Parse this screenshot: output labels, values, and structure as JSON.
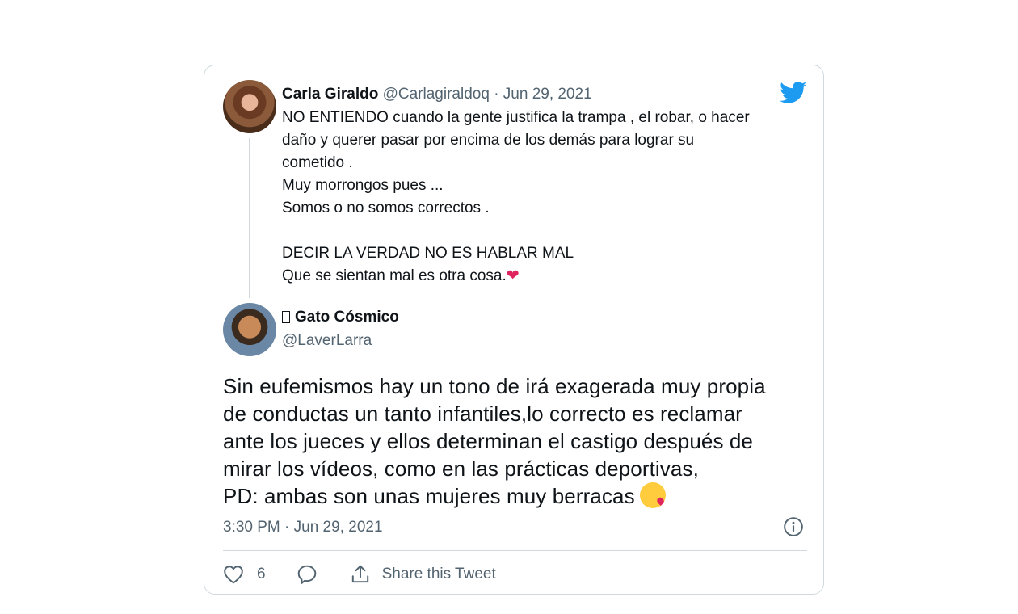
{
  "quoted_tweet": {
    "name": "Carla Giraldo",
    "handle": "@Carlagiraldoq",
    "separator": "·",
    "date": "Jun 29, 2021",
    "lines": [
      "NO ENTIENDO  cuando la gente justifica la trampa , el robar, o hacer",
      "daño y querer pasar por encima  de los demás para lograr su",
      "cometido .",
      "Muy morrongos pues ...",
      "Somos o no somos correctos .",
      "",
      "DECIR LA VERDAD NO ES HABLAR MAL",
      "Que se sientan mal es otra cosa."
    ],
    "trailing_emoji": "❤"
  },
  "reply": {
    "name": "Gato Cósmico",
    "handle": "@LaverLarra",
    "lines": [
      "Sin eufemismos hay un tono de irá exagerada muy propia",
      "de conductas un tanto infantiles,lo correcto es reclamar",
      "ante los jueces y ellos determinan el castigo después de",
      "mirar los vídeos, como en las prácticas deportivas,",
      "PD: ambas son unas mujeres muy berracas"
    ],
    "timestamp": "3:30 PM · Jun 29, 2021"
  },
  "actions": {
    "like_count": "6",
    "share_label": "Share this Tweet"
  },
  "colors": {
    "text": "#0f1419",
    "muted": "#536471",
    "border": "#cfd9de",
    "brand": "#1d9bf0",
    "heart": "#e0245e"
  },
  "icons": [
    "twitter-bird-icon",
    "heart-icon",
    "reply-icon",
    "share-icon",
    "info-icon"
  ]
}
